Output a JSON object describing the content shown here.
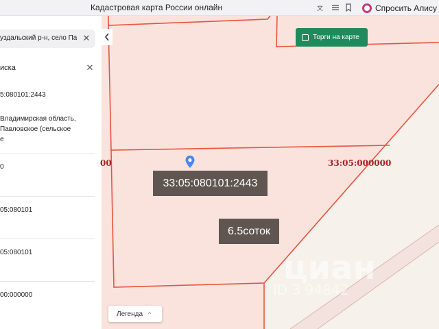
{
  "browser": {
    "title": "Кадастровая карта России онлайн",
    "alisa_label": "Спросить Алису А"
  },
  "panel": {
    "search_text": "уздальский р-н, село Па",
    "section_title": "иска",
    "items": [
      {
        "lines": [
          "5:080101:2443"
        ]
      },
      {
        "lines": [
          "Владимирская область,",
          "Павловское (сельское",
          "е"
        ]
      },
      {
        "lines": [
          "0"
        ]
      },
      {
        "lines": [
          "05:080101"
        ]
      },
      {
        "lines": [
          "05:080101"
        ]
      },
      {
        "lines": [
          "00:000000"
        ]
      }
    ]
  },
  "map": {
    "torgi_label": "Торги на карте",
    "parcel_label": "33:05:080101:2443",
    "area_label": "6.5соток",
    "cad_block_right": "33:05:000000",
    "cad_block_left": "00",
    "legend_label": "Легенда",
    "watermark": "циан",
    "watermark_sub": "ID 3    94842",
    "colors": {
      "parcel_fill": "#fbe3dd",
      "parcel_border": "#e4553f",
      "label_bg": "#5f5651",
      "torgi_bg": "#1f8a5b",
      "cad_label": "#a82027",
      "pin": "#4a86f0"
    }
  },
  "icons": {
    "translate": "translate-icon",
    "menu": "menu-icon",
    "bookmark": "bookmark-icon",
    "alisa": "alisa-icon",
    "collapse": "chevron-left-icon",
    "pin": "location-pin-icon"
  }
}
